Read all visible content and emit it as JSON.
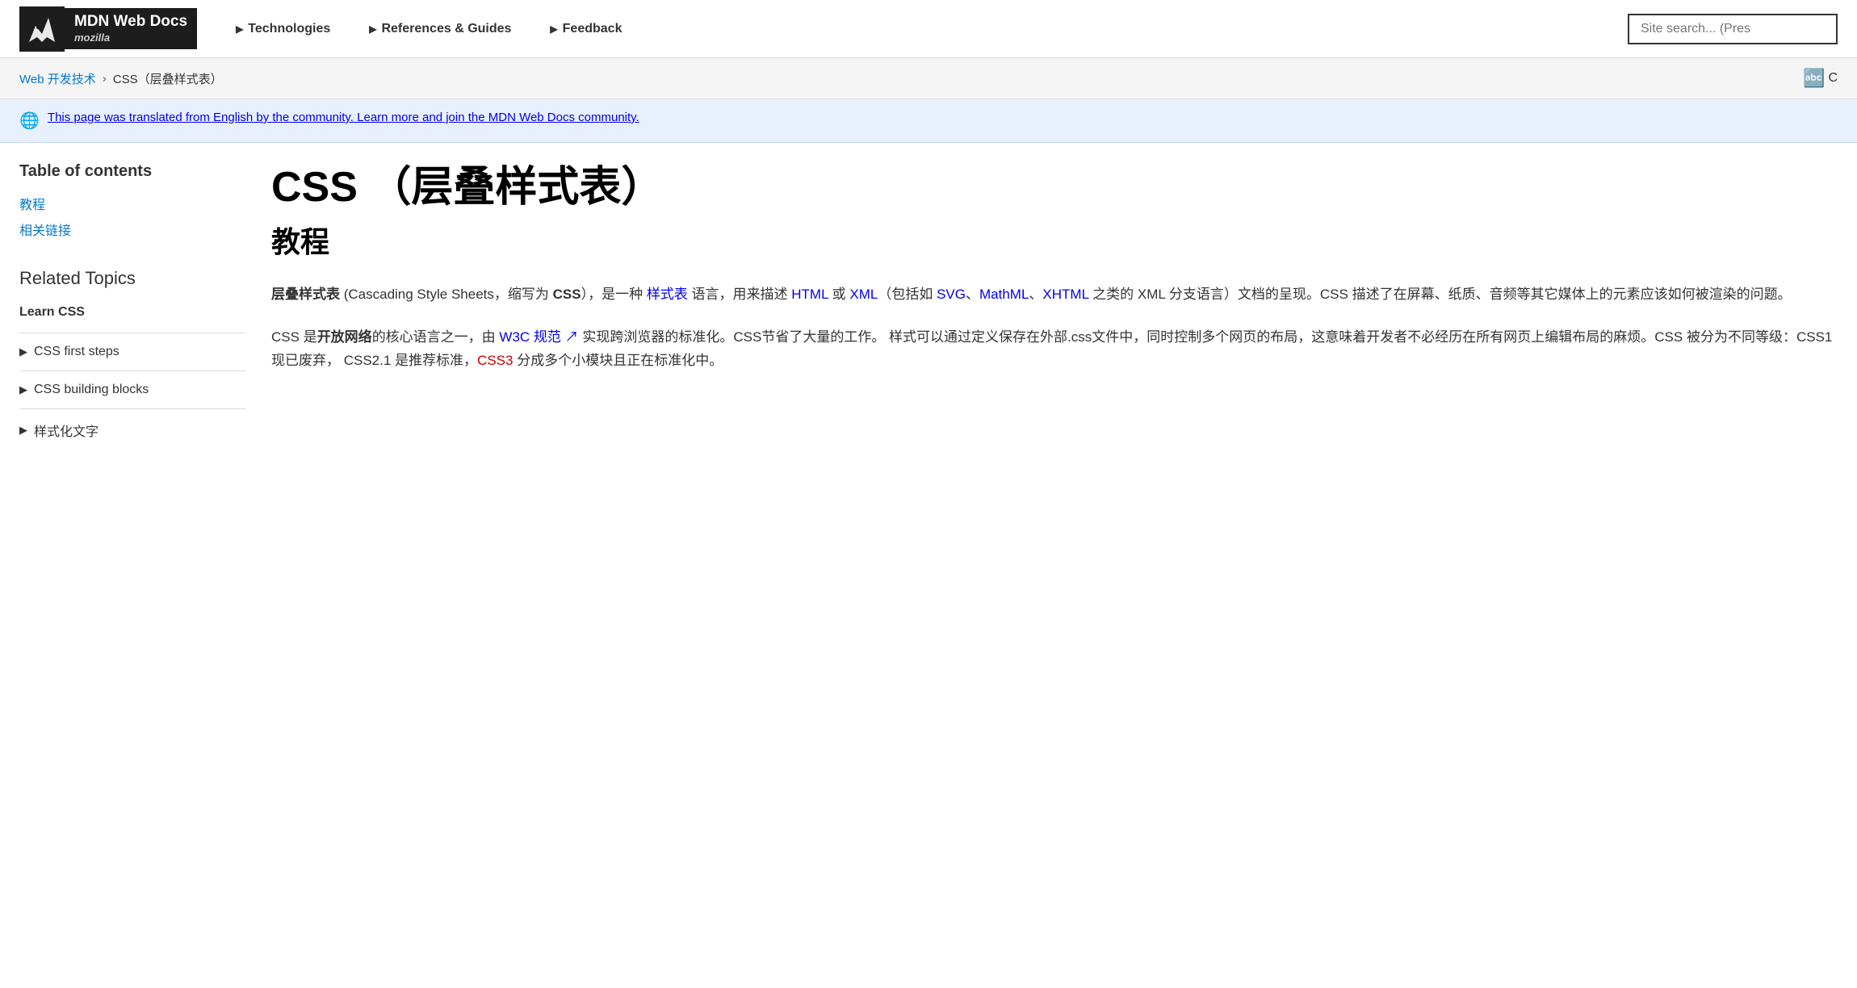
{
  "header": {
    "logo_title": "MDN Web Docs",
    "logo_subtitle": "mozilla",
    "nav": [
      {
        "label": "Technologies",
        "arrow": "▶"
      },
      {
        "label": "References & Guides",
        "arrow": "▶"
      },
      {
        "label": "Feedback",
        "arrow": "▶"
      }
    ],
    "search_placeholder": "Site search... (Pres"
  },
  "breadcrumb": {
    "parent_label": "Web 开发技术",
    "separator": "›",
    "current_label": "CSS（层叠样式表）"
  },
  "translation_notice": {
    "globe_icon": "🌐",
    "text": "This page was translated from English by the community. Learn more and join the MDN Web Docs community."
  },
  "sidebar": {
    "toc_title": "Table of contents",
    "toc_links": [
      {
        "label": "教程"
      },
      {
        "label": "相关链接"
      }
    ],
    "related_topics_title": "Related Topics",
    "learn_css_label": "Learn CSS",
    "sidebar_items": [
      {
        "label": "CSS first steps",
        "arrow": "▶"
      },
      {
        "label": "CSS building blocks",
        "arrow": "▶"
      },
      {
        "label": "样式化文字",
        "arrow": "▶"
      }
    ]
  },
  "content": {
    "page_title": "CSS （层叠样式表）",
    "section_title": "教程",
    "paragraph1": {
      "prefix": "层叠样式表 (Cascading Style Sheets，缩写为 ",
      "css_bold": "CSS",
      "suffix1": "），是一种 ",
      "link1_text": "样式表",
      "between1": " 语言，用来描述 ",
      "link2_text": "HTML",
      "between2": " 或 ",
      "link3_text": "XML",
      "suffix2": "（包括如 ",
      "link4_text": "SVG",
      "between3": "、",
      "link5_text": "MathML",
      "between4": "、",
      "link6_text": "XHTML",
      "suffix3": " 之类的 XML 分支语言）文档的呈现。CSS 描述了在屏幕、纸质、音频等其它媒体上的元素应该如何被渲染的问题。"
    },
    "paragraph2": {
      "prefix": "CSS 是",
      "bold1": "开放网络",
      "middle1": "的核心语言之一，由 ",
      "link1_text": "W3C 规范",
      "link1_ext": "↗",
      "middle2": " 实现跨浏览器的标准化。CSS节省了大量的工作。 样式可以通过定义保存在外部.css文件中，同时控制多个网页的布局，这意味着开发者不必经历在所有网页上编辑布局的麻烦。CSS 被分为不同等级：CSS1 现已废弃，  CSS2.1 是推荐标准，",
      "link2_text": "CSS3",
      "suffix": " 分成多个小模块且正在标准化中。"
    }
  }
}
